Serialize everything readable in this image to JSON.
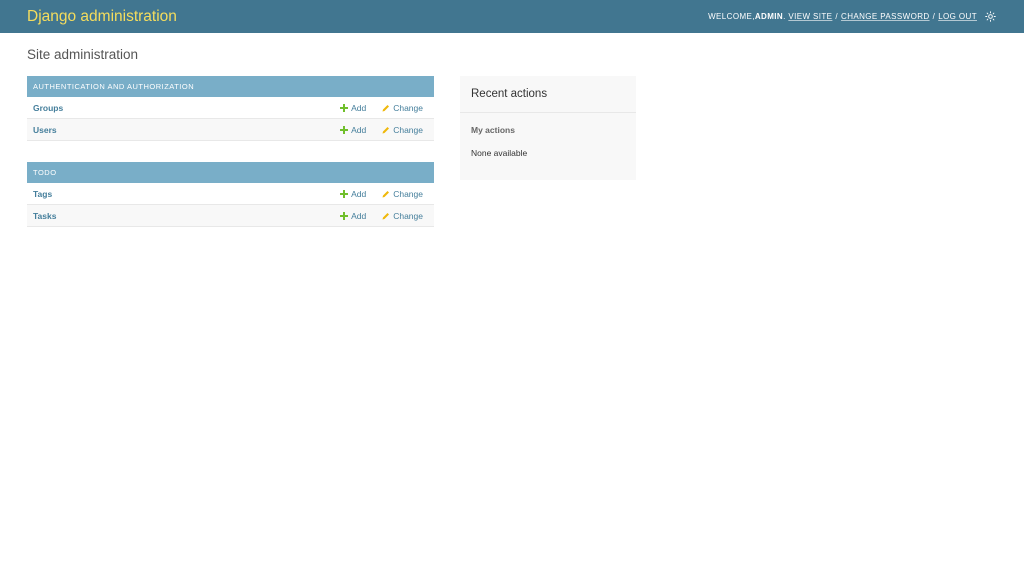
{
  "header": {
    "branding": "Django administration",
    "welcome_prefix": "Welcome, ",
    "username": "admin",
    "view_site": "View site",
    "change_password": "Change password",
    "log_out": "Log out",
    "separator": "/",
    "theme_icon": "sun-icon",
    "accent_color": "#417690",
    "branding_color": "#f5dd5d"
  },
  "page_title": "Site administration",
  "apps": [
    {
      "caption": "Authentication and Authorization",
      "models": [
        {
          "name": "Groups",
          "add": "Add",
          "change": "Change"
        },
        {
          "name": "Users",
          "add": "Add",
          "change": "Change"
        }
      ]
    },
    {
      "caption": "Todo",
      "models": [
        {
          "name": "Tags",
          "add": "Add",
          "change": "Change"
        },
        {
          "name": "Tasks",
          "add": "Add",
          "change": "Change"
        }
      ]
    }
  ],
  "recent_actions": {
    "title": "Recent actions",
    "subtitle": "My actions",
    "empty_text": "None available"
  }
}
